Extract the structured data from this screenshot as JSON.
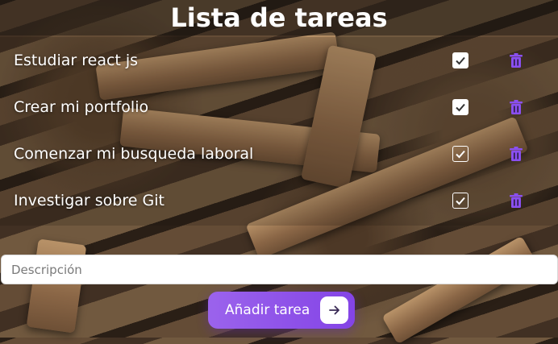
{
  "app": {
    "title": "Lista de tareas"
  },
  "tasks": [
    {
      "label": "Estudiar react js",
      "done": true
    },
    {
      "label": "Crear mi portfolio",
      "done": true
    },
    {
      "label": "Comenzar mi busqueda laboral",
      "done": false
    },
    {
      "label": "Investigar sobre Git",
      "done": false
    }
  ],
  "form": {
    "description_placeholder": "Descripción",
    "description_value": "",
    "add_button_label": "Añadir tarea"
  },
  "icons": {
    "check": "check-icon",
    "delete": "trash-icon",
    "submit": "arrow-right-icon"
  },
  "colors": {
    "accent": "#8a4ff0",
    "trash": "#8a4ff0",
    "text": "#ffffff"
  }
}
